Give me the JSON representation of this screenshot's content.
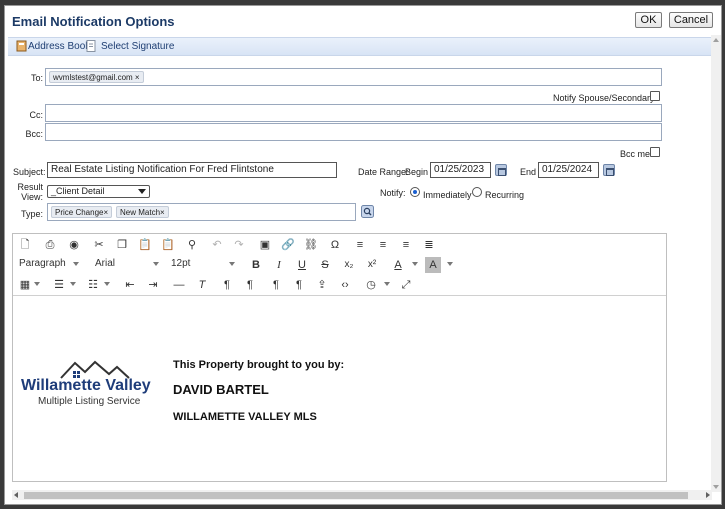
{
  "dialog": {
    "title": "Email Notification Options",
    "ok_label": "OK",
    "cancel_label": "Cancel"
  },
  "linkbar": {
    "address_book": "Address Book",
    "select_signature": "Select Signature"
  },
  "form": {
    "to_label": "To:",
    "to_chips": [
      "wvmlstest@gmail.com"
    ],
    "notify_spouse_label": "Notify Spouse/Secondary",
    "cc_label": "Cc:",
    "bcc_label": "Bcc:",
    "bcc_me_label": "Bcc me",
    "subject_label": "Subject:",
    "subject_value": "Real Estate Listing Notification For Fred Flintstone",
    "date_range_label": "Date Range:",
    "begin_label": "Begin",
    "begin_value": "01/25/2023",
    "end_label": "End",
    "end_value": "01/25/2024",
    "result_view_label_1": "Result",
    "result_view_label_2": "View:",
    "result_view_value": "_Client Detail",
    "notify_label": "Notify:",
    "notify_immediately": "Immediately",
    "notify_recurring": "Recurring",
    "type_label": "Type:",
    "type_chips": [
      "Price Change",
      "New Match"
    ]
  },
  "editor": {
    "paragraph_select": "Paragraph",
    "font_select": "Arial",
    "size_select": "12pt",
    "logo_line1": "Willamette Valley",
    "logo_line2": "Multiple Listing Service",
    "line1": "This Property brought to you by:",
    "line2": "DAVID BARTEL",
    "line3": "WILLAMETTE VALLEY MLS"
  },
  "colors": {
    "title": "#1c3a66",
    "logo": "#1f3d7a",
    "radio_selected": "#1a5fd0"
  }
}
